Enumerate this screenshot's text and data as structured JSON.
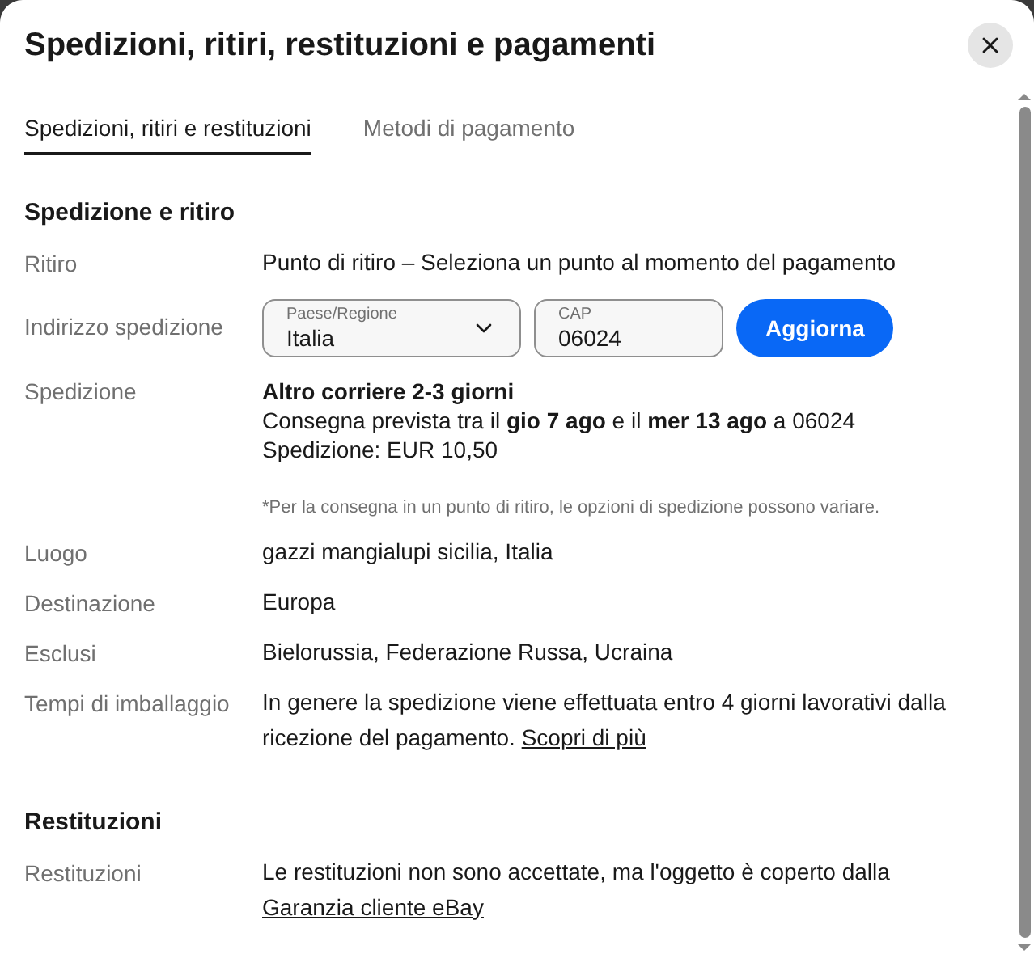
{
  "dialog": {
    "title": "Spedizioni, ritiri, restituzioni e pagamenti"
  },
  "tabs": [
    {
      "label": "Spedizioni, ritiri e restituzioni",
      "selected": true
    },
    {
      "label": "Metodi di pagamento",
      "selected": false
    }
  ],
  "sections": [
    {
      "title": "Spedizione e ritiro",
      "rows": [
        {
          "kind": "text",
          "label": "Ritiro",
          "value": "Punto di ritiro – Seleziona un punto al momento del pagamento"
        },
        {
          "kind": "address",
          "label": "Indirizzo spedizione",
          "country": {
            "label": "Paese/Regione",
            "value": "Italia"
          },
          "zip": {
            "label": "CAP",
            "value": "06024"
          },
          "button": "Aggiorna"
        },
        {
          "kind": "shipping",
          "label": "Spedizione",
          "service": "Altro corriere 2-3 giorni",
          "delivery": "Consegna prevista tra il **gio 7 ago** e il **mer 13 ago** a 06024",
          "cost": "Spedizione: EUR 10,50",
          "note": "*Per la consegna in un punto di ritiro, le opzioni di spedizione possono variare."
        },
        {
          "kind": "text",
          "label": "Luogo",
          "value": "gazzi mangialupi sicilia, Italia"
        },
        {
          "kind": "text",
          "label": "Destinazione",
          "value": "Europa"
        },
        {
          "kind": "text",
          "label": "Esclusi",
          "value": "Bielorussia, Federazione Russa, Ucraina"
        },
        {
          "kind": "text",
          "label": "Tempi di imballaggio",
          "value": "In genere la spedizione viene effettuata entro 4 giorni lavorativi dalla ricezione del pagamento.",
          "link": "Scopri di più"
        }
      ]
    },
    {
      "title": "Restituzioni",
      "rows": [
        {
          "kind": "text",
          "label": "Restituzioni",
          "value": "Le restituzioni non sono accettate, ma l'oggetto è coperto dalla",
          "link": "Garanzia cliente eBay"
        }
      ]
    }
  ]
}
